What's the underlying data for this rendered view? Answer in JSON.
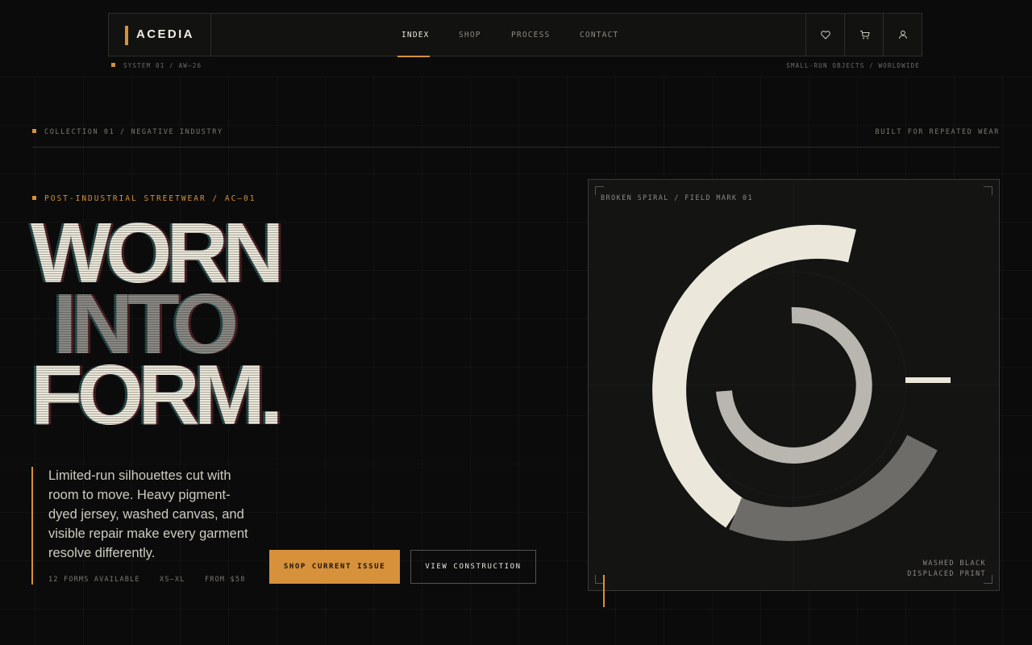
{
  "brand": {
    "name": "ACEDIA"
  },
  "nav": {
    "links": [
      {
        "label": "INDEX",
        "active": true
      },
      {
        "label": "SHOP",
        "active": false
      },
      {
        "label": "PROCESS",
        "active": false
      },
      {
        "label": "CONTACT",
        "active": false
      }
    ],
    "icons": [
      "heart-icon",
      "cart-icon",
      "user-icon"
    ]
  },
  "subbar": {
    "left": "SYSTEM 01 / AW—26",
    "right": "SMALL-RUN OBJECTS / WORLDWIDE"
  },
  "collection": {
    "left": "COLLECTION 01 / NEGATIVE INDUSTRY",
    "right": "BUILT FOR REPEATED WEAR"
  },
  "hero": {
    "eyebrow": "POST-INDUSTRIAL STREETWEAR / AC—01",
    "headline": [
      "WORN",
      "INTO",
      "FORM."
    ],
    "description": "Limited-run silhouettes cut with room to move. Heavy pigment-dyed jersey, washed canvas, and visible repair make every garment resolve differently.",
    "meta": [
      "12 FORMS AVAILABLE",
      "XS—XL",
      "FROM $58"
    ],
    "primary_cta": "SHOP CURRENT ISSUE",
    "secondary_cta": "VIEW CONSTRUCTION"
  },
  "artwork": {
    "label": "BROKEN SPIRAL / FIELD MARK 01",
    "caption_line1": "WASHED BLACK",
    "caption_line2": "DISPLACED PRINT"
  },
  "colors": {
    "accent": "#d7913a",
    "background": "#0b0b0b",
    "ink": "#ebe7da"
  }
}
